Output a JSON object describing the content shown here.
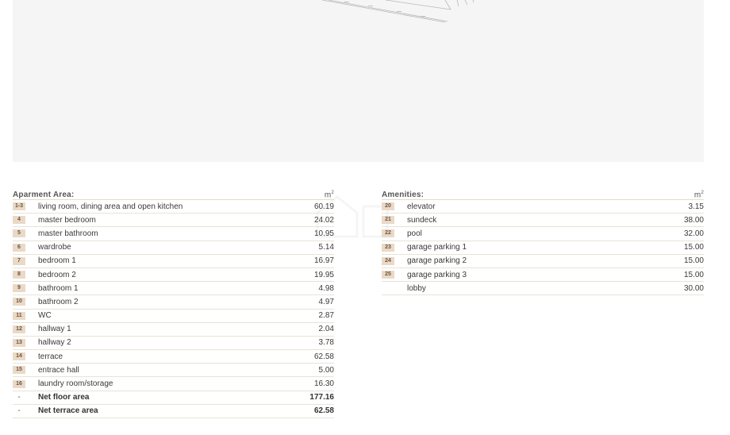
{
  "apartment": {
    "header": "Aparment Area:",
    "unit": "m",
    "unit_sup": "2",
    "rows": [
      {
        "num": "1-3",
        "name": "living room, dining area and open kitchen",
        "val": "60.19"
      },
      {
        "num": "4",
        "name": "master bedroom",
        "val": "24.02"
      },
      {
        "num": "5",
        "name": "master bathroom",
        "val": "10.95"
      },
      {
        "num": "6",
        "name": "wardrobe",
        "val": "5.14"
      },
      {
        "num": "7",
        "name": "bedroom 1",
        "val": "16.97"
      },
      {
        "num": "8",
        "name": "bedroom 2",
        "val": "19.95"
      },
      {
        "num": "9",
        "name": "bathroom 1",
        "val": "4.98"
      },
      {
        "num": "10",
        "name": "bathroom 2",
        "val": "4.97"
      },
      {
        "num": "11",
        "name": "WC",
        "val": "2.87"
      },
      {
        "num": "12",
        "name": "hallway 1",
        "val": "2.04"
      },
      {
        "num": "13",
        "name": "hallway 2",
        "val": "3.78"
      },
      {
        "num": "14",
        "name": "terrace",
        "val": "62.58"
      },
      {
        "num": "15",
        "name": "entrace hall",
        "val": "5.00"
      },
      {
        "num": "16",
        "name": "laundry room/storage",
        "val": "16.30"
      }
    ],
    "totals": [
      {
        "num": "-",
        "name": "Net floor area",
        "val": "177.16"
      },
      {
        "num": "-",
        "name": "Net terrace area",
        "val": "62.58"
      }
    ]
  },
  "amenities": {
    "header": "Amenities:",
    "unit": "m",
    "unit_sup": "2",
    "rows": [
      {
        "num": "20",
        "name": "elevator",
        "val": "3.15"
      },
      {
        "num": "21",
        "name": "sundeck",
        "val": "38.00"
      },
      {
        "num": "22",
        "name": "pool",
        "val": "32.00"
      },
      {
        "num": "23",
        "name": "garage parking 1",
        "val": "15.00"
      },
      {
        "num": "24",
        "name": "garage parking 2",
        "val": "15.00"
      },
      {
        "num": "25",
        "name": "garage parking 3",
        "val": "15.00"
      },
      {
        "num": "",
        "name": "lobby",
        "val": "30.00"
      }
    ]
  },
  "colors": {
    "badge_bg": "#ead9c6",
    "plan_bg": "#f5f5f5",
    "row_border": "#e8e3d9"
  }
}
